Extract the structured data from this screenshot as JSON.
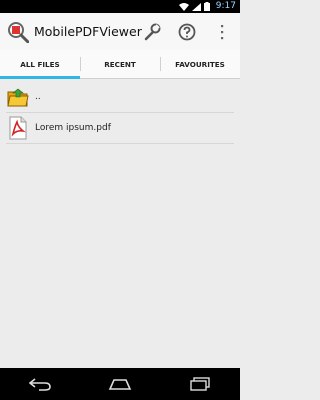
{
  "status": {
    "time": "9:17"
  },
  "app": {
    "title": "MobilePDFViewer"
  },
  "tabs": [
    {
      "label": "ALL FILES",
      "active": true
    },
    {
      "label": "RECENT",
      "active": false
    },
    {
      "label": "FAVOURITES",
      "active": false
    }
  ],
  "files": [
    {
      "name": "..",
      "icon": "folder-up-icon"
    },
    {
      "name": "Lorem ipsum.pdf",
      "icon": "pdf-icon"
    }
  ],
  "colors": {
    "accent": "#33b5e5",
    "statusbar": "#000000",
    "background": "#ececec"
  }
}
